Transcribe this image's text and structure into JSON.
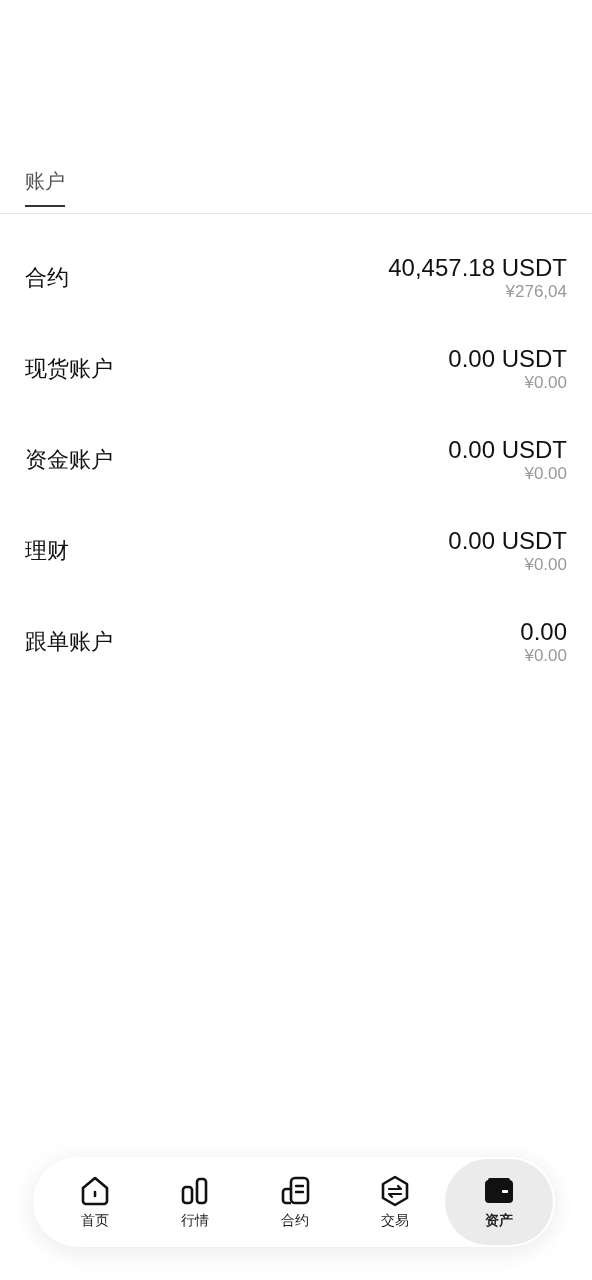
{
  "tabs": [
    {
      "label": "账户",
      "selected": true
    }
  ],
  "accounts": [
    {
      "name": "合约",
      "amount": "40,457.18 USDT",
      "cny": "¥276,04"
    },
    {
      "name": "现货账户",
      "amount": "0.00 USDT",
      "cny": "¥0.00"
    },
    {
      "name": "资金账户",
      "amount": "0.00 USDT",
      "cny": "¥0.00"
    },
    {
      "name": "理财",
      "amount": "0.00 USDT",
      "cny": "¥0.00"
    },
    {
      "name": "跟单账户",
      "amount": "0.00",
      "cny": "¥0.00"
    }
  ],
  "bottom_nav": [
    {
      "kind": "home",
      "label": "首页",
      "selected": false
    },
    {
      "kind": "market",
      "label": "行情",
      "selected": false
    },
    {
      "kind": "contract",
      "label": "合约",
      "selected": false
    },
    {
      "kind": "trade",
      "label": "交易",
      "selected": false
    },
    {
      "kind": "assets",
      "label": "资产",
      "selected": true
    }
  ]
}
